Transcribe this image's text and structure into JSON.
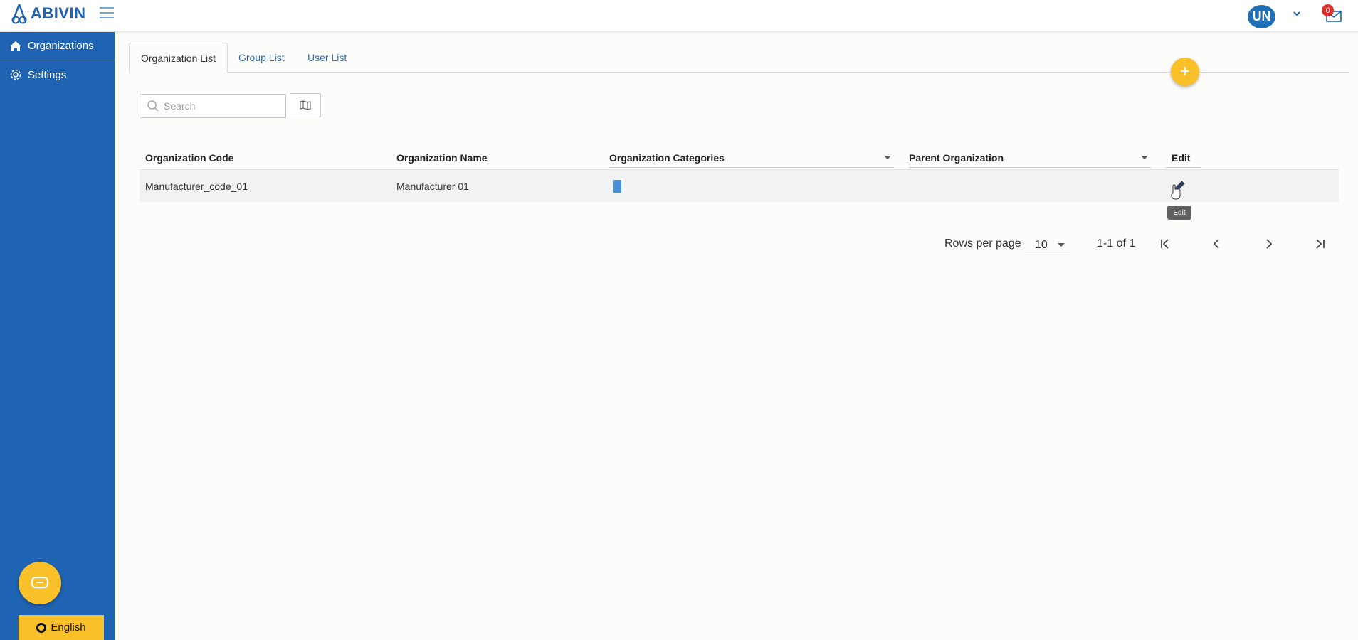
{
  "app": {
    "logo_text": "ABIVIN",
    "brand_color": "#1f64b3",
    "accent_color": "#f9c02a"
  },
  "header": {
    "avatar_initials": "UN",
    "mail_badge_count": "0"
  },
  "sidebar": {
    "items": [
      {
        "label": "Organizations",
        "icon": "home-icon"
      },
      {
        "label": "Settings",
        "icon": "gear-icon"
      }
    ],
    "language_label": "English"
  },
  "tabs": [
    {
      "label": "Organization List",
      "active": true
    },
    {
      "label": "Group List",
      "active": false
    },
    {
      "label": "User List",
      "active": false
    }
  ],
  "add_button_symbol": "+",
  "search": {
    "placeholder": "Search",
    "value": ""
  },
  "table": {
    "columns": [
      "Organization Code",
      "Organization Name",
      "Organization Categories",
      "Parent Organization",
      "Edit"
    ],
    "rows": [
      {
        "code": "Manufacturer_code_01",
        "name": "Manufacturer 01",
        "categories": "",
        "parent": ""
      }
    ],
    "edit_tooltip": "Edit"
  },
  "pagination": {
    "rows_per_page_label": "Rows per page",
    "rows_per_page_value": "10",
    "range_text": "1-1 of 1"
  }
}
